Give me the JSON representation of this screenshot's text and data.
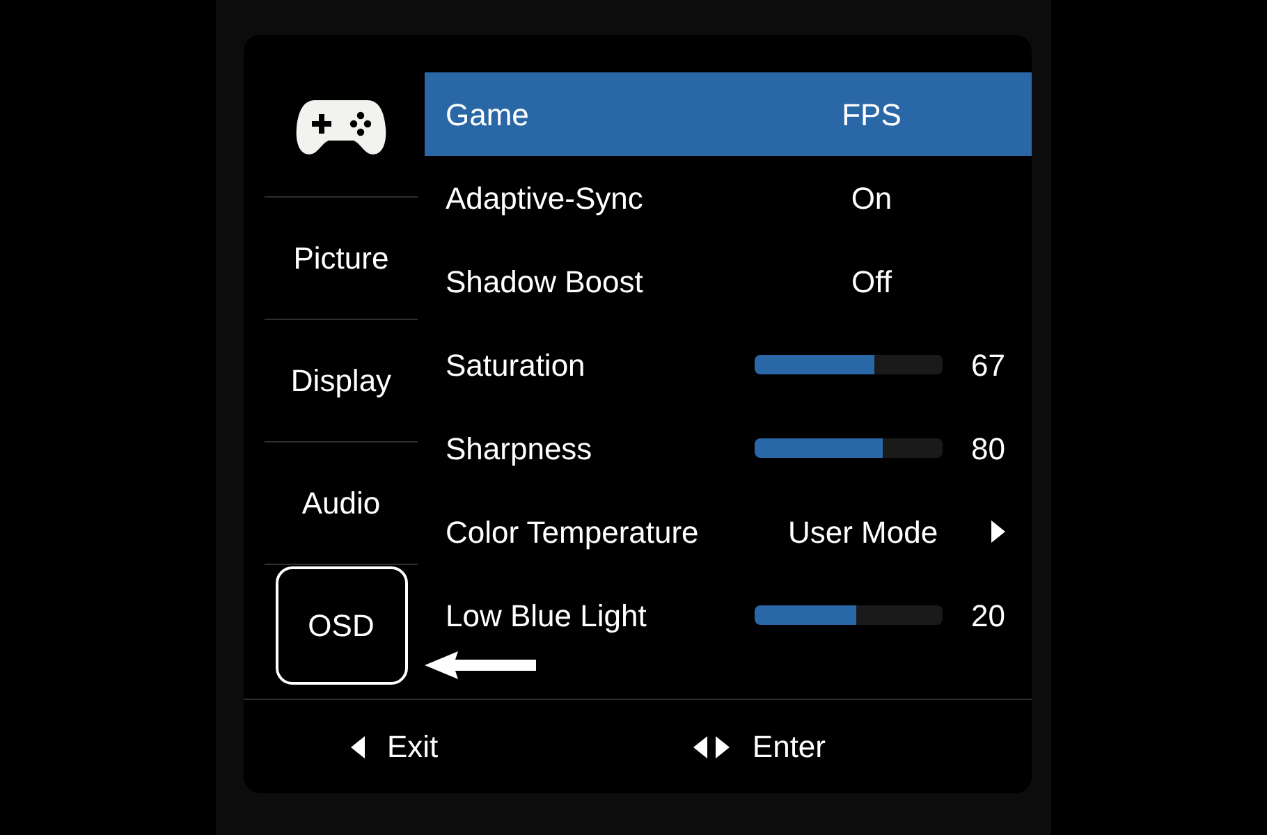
{
  "sidebar": {
    "items": [
      {
        "kind": "icon",
        "selected": false
      },
      {
        "kind": "text",
        "label": "Picture",
        "selected": false
      },
      {
        "kind": "text",
        "label": "Display",
        "selected": false
      },
      {
        "kind": "text",
        "label": "Audio",
        "selected": false
      },
      {
        "kind": "text",
        "label": "OSD",
        "selected": true
      }
    ]
  },
  "menu": {
    "rows": [
      {
        "kind": "value",
        "label": "Game",
        "value": "FPS",
        "selected": true
      },
      {
        "kind": "value",
        "label": "Adaptive-Sync",
        "value": "On",
        "selected": false
      },
      {
        "kind": "value",
        "label": "Shadow Boost",
        "value": "Off",
        "selected": false
      },
      {
        "kind": "slider",
        "label": "Saturation",
        "level": 0.64,
        "reading": "67",
        "selected": false
      },
      {
        "kind": "slider",
        "label": "Sharpness",
        "level": 0.68,
        "reading": "80",
        "selected": false
      },
      {
        "kind": "submenu",
        "label": "Color Temperature",
        "value": "User Mode",
        "selected": false
      },
      {
        "kind": "slider",
        "label": "Low Blue Light",
        "level": 0.54,
        "reading": "20",
        "selected": false
      }
    ]
  },
  "footer": {
    "hints": [
      {
        "kind": "back",
        "label": "Exit"
      },
      {
        "kind": "leftright",
        "label": "Enter"
      }
    ]
  }
}
